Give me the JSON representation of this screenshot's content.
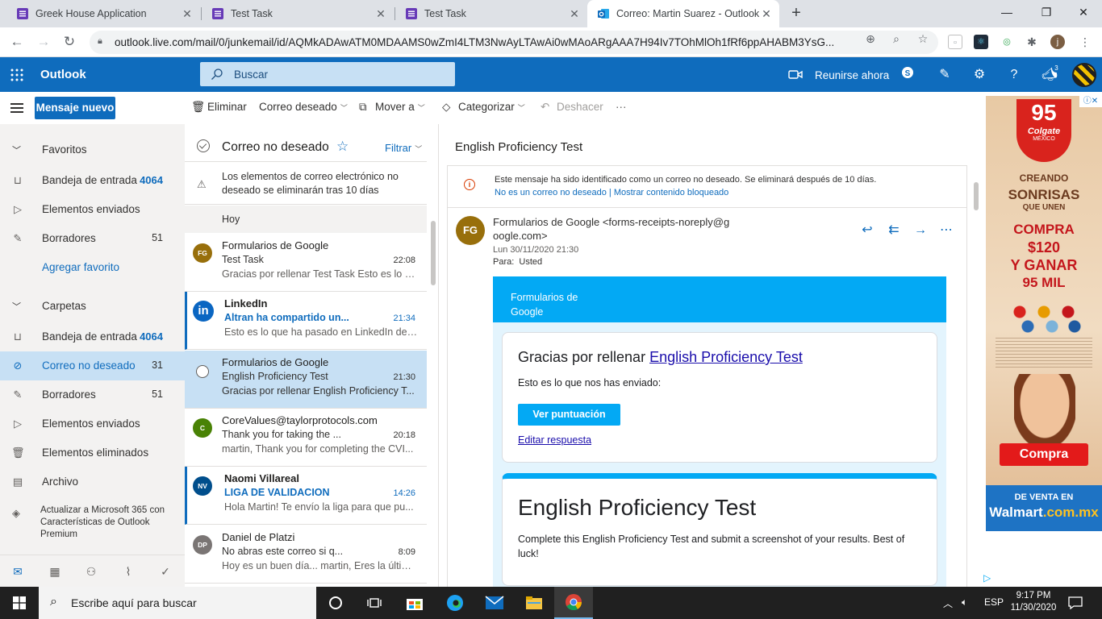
{
  "browser": {
    "tabs": [
      {
        "title": "Greek House Application"
      },
      {
        "title": "Test Task"
      },
      {
        "title": "Test Task"
      },
      {
        "title": "Correo: Martin Suarez - Outlook"
      }
    ],
    "url": "outlook.live.com/mail/0/junkemail/id/AQMkADAwATM0MDAAMS0wZmI4LTM3NwAyLTAwAi0wMAoARgAAA7H94Iv7TOhMlOh1fRf6ppAHABM3YsG...",
    "profile_initial": "j"
  },
  "header": {
    "brand": "Outlook",
    "search_placeholder": "Buscar",
    "meet_now": "Reunirse ahora",
    "notifications_count": "3"
  },
  "commands": {
    "new_message": "Mensaje nuevo",
    "delete": "Eliminar",
    "junk": "Correo deseado",
    "move": "Mover a",
    "categorize": "Categorizar",
    "undo": "Deshacer",
    "more": "···"
  },
  "nav": {
    "favorites": "Favoritos",
    "fav_items": [
      {
        "label": "Bandeja de entrada",
        "count": "4064"
      },
      {
        "label": "Elementos enviados",
        "count": ""
      },
      {
        "label": "Borradores",
        "count": "51"
      }
    ],
    "add_favorite": "Agregar favorito",
    "folders": "Carpetas",
    "folder_items": [
      {
        "label": "Bandeja de entrada",
        "count": "4064"
      },
      {
        "label": "Correo no deseado",
        "count": "31"
      },
      {
        "label": "Borradores",
        "count": "51"
      },
      {
        "label": "Elementos enviados",
        "count": ""
      },
      {
        "label": "Elementos eliminados",
        "count": ""
      },
      {
        "label": "Archivo",
        "count": ""
      }
    ],
    "upgrade": "Actualizar a Microsoft 365 con Características de Outlook Premium"
  },
  "list": {
    "title": "Correo no deseado",
    "filter": "Filtrar",
    "junk_note": "Los elementos de correo electrónico no deseado se eliminarán tras 10 días",
    "day": "Hoy",
    "messages": [
      {
        "initials": "FG",
        "color": "#986f0b",
        "from": "Formularios de Google",
        "subject": "Test Task",
        "time": "22:08",
        "preview": "Gracias por rellenar Test Task Esto es lo q..."
      },
      {
        "initials": "in",
        "color": "#0a66c2",
        "from": "LinkedIn",
        "subject": "Altran ha compartido un...",
        "time": "21:34",
        "preview": "Esto es lo que ha pasado en LinkedIn des..."
      },
      {
        "initials": "",
        "color": "#ffffff",
        "from": "Formularios de Google",
        "subject": "English Proficiency Test",
        "time": "21:30",
        "preview": "Gracias por rellenar English Proficiency T..."
      },
      {
        "initials": "C",
        "color": "#498205",
        "from": "CoreValues@taylorprotocols.com",
        "subject": "Thank you for taking the ...",
        "time": "20:18",
        "preview": "martin, Thank you for completing the CVI..."
      },
      {
        "initials": "NV",
        "color": "#004e8c",
        "from": "Naomi Villareal",
        "subject": "LIGA DE VALIDACION",
        "time": "14:26",
        "preview": "Hola Martin! Te envío la liga para que pu..."
      },
      {
        "initials": "DP",
        "color": "#7a7574",
        "from": "Daniel de Platzi",
        "subject": "No abras este correo si q...",
        "time": "8:09",
        "preview": "Hoy es un buen día... martin, Eres la últim..."
      }
    ]
  },
  "reading": {
    "subject": "English Proficiency Test",
    "junk_warning": "Este mensaje ha sido identificado como un correo no deseado. Se eliminará después de 10 días.",
    "not_junk_link": "No es un correo no deseado",
    "separator": "|",
    "show_blocked_link": "Mostrar contenido bloqueado",
    "sender_initials": "FG",
    "sender_line1": "Formularios de Google <forms-receipts-noreply@g",
    "sender_line2": "oogle.com>",
    "date": "Lun 30/11/2020 21:30",
    "to_label": "Para:",
    "to_value": "Usted",
    "form": {
      "logo_alt": "Formularios de Google",
      "thanks_prefix": "Gracias por rellenar",
      "thanks_link": "English Proficiency Test",
      "sent_text": "Esto es lo que nos has enviado:",
      "score_button": "Ver puntuación",
      "edit_link": "Editar respuesta",
      "card_title": "English Proficiency Test",
      "card_desc": "Complete this English Proficiency Test and submit a screenshot of your results. Best of luck!"
    }
  },
  "ad": {
    "years": "95",
    "brand": "Colgate",
    "country": "MÉXICO",
    "line1": "CREANDO",
    "line2": "SONRISAS",
    "line3": "QUE UNEN",
    "line4": "COMPRA",
    "line5": "$120",
    "line6": "Y GANAR",
    "line7": "95 MIL",
    "cta": "Compra",
    "venta": "DE VENTA EN",
    "store": "Walmart",
    "store_suffix": ".com.mx"
  },
  "taskbar": {
    "search": "Escribe aquí para buscar",
    "lang": "ESP",
    "time": "9:17 PM",
    "date": "11/30/2020"
  }
}
